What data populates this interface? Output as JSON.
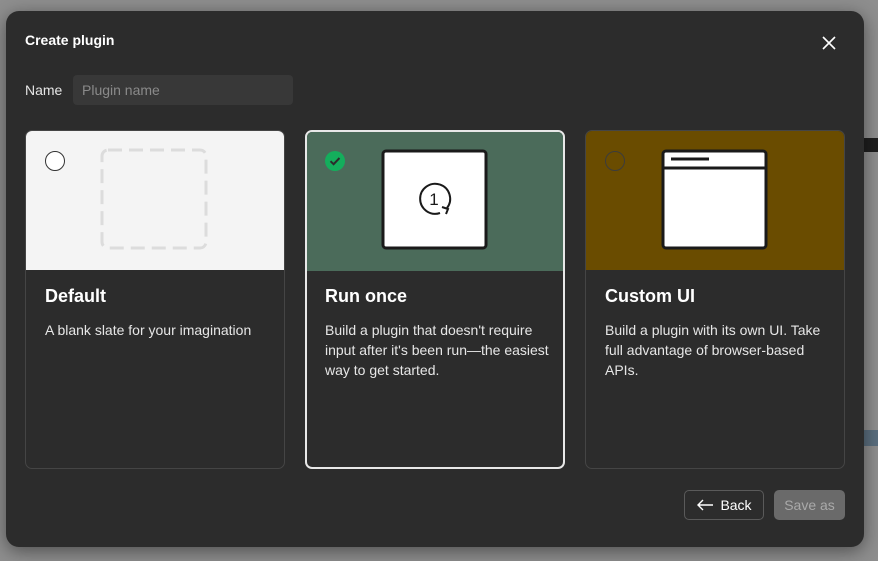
{
  "dialog": {
    "title": "Create plugin",
    "close_icon": "close-icon"
  },
  "name_field": {
    "label": "Name",
    "placeholder": "Plugin name",
    "value": ""
  },
  "options": [
    {
      "id": "default",
      "heading": "Default",
      "description": "A blank slate for your imagination",
      "selected": false,
      "art_color": "#f4f4f4"
    },
    {
      "id": "run-once",
      "heading": "Run once",
      "description": "Build a plugin that doesn't require input after it's been run—the easiest way to get started.",
      "selected": true,
      "art_color": "#4b6b5a",
      "badge_text": "1"
    },
    {
      "id": "custom-ui",
      "heading": "Custom UI",
      "description": "Build a plugin with its own UI. Take full advantage of browser-based APIs.",
      "selected": false,
      "art_color": "#6a4c00"
    }
  ],
  "footer": {
    "back_label": "Back",
    "save_label": "Save as"
  },
  "colors": {
    "dialog_bg": "#2c2c2c",
    "check_green": "#14ae5c",
    "disabled_button": "#6a6a6a"
  }
}
